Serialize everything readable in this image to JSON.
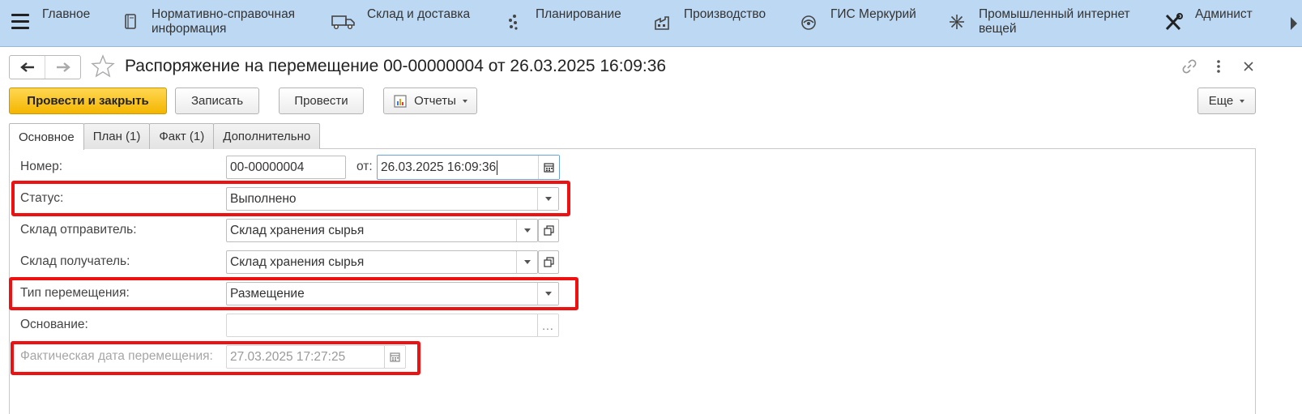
{
  "sections": [
    {
      "label": "Главное",
      "icon": "menu-icon"
    },
    {
      "label": "Нормативно-справочная\nинформация",
      "icon": "reference-book-icon"
    },
    {
      "label": "Склад и доставка",
      "icon": "truck-icon"
    },
    {
      "label": "Планирование",
      "icon": "planning-dots-icon"
    },
    {
      "label": "Производство",
      "icon": "factory-icon"
    },
    {
      "label": "ГИС Меркурий",
      "icon": "mercury-icon"
    },
    {
      "label": "Промышленный интернет\nвещей",
      "icon": "iot-icon"
    },
    {
      "label": "Админист",
      "icon": "tools-icon"
    }
  ],
  "document": {
    "title": "Распоряжение на перемещение 00-00000004 от 26.03.2025 16:09:36"
  },
  "toolbar": {
    "post_and_close": "Провести и закрыть",
    "save": "Записать",
    "post": "Провести",
    "reports": "Отчеты",
    "more": "Еще"
  },
  "tabs": [
    {
      "label": "Основное",
      "active": true
    },
    {
      "label": "План (1)",
      "active": false
    },
    {
      "label": "Факт (1)",
      "active": false
    },
    {
      "label": "Дополнительно",
      "active": false
    }
  ],
  "form": {
    "number": {
      "label": "Номер:",
      "value": "00-00000004"
    },
    "date": {
      "label": "от:",
      "value": "26.03.2025 16:09:36"
    },
    "status": {
      "label": "Статус:",
      "value": "Выполнено"
    },
    "sender": {
      "label": "Склад отправитель:",
      "value": "Склад хранения сырья"
    },
    "receiver": {
      "label": "Склад получатель:",
      "value": "Склад хранения сырья"
    },
    "move_type": {
      "label": "Тип перемещения:",
      "value": "Размещение"
    },
    "basis": {
      "label": "Основание:",
      "value": ""
    },
    "actual_date": {
      "label": "Фактическая дата перемещения:",
      "value": "27.03.2025 17:27:25"
    }
  },
  "colors": {
    "section_panel": "#bcd8f3",
    "primary_button": "#f4b600",
    "highlight": "#ee1111"
  }
}
